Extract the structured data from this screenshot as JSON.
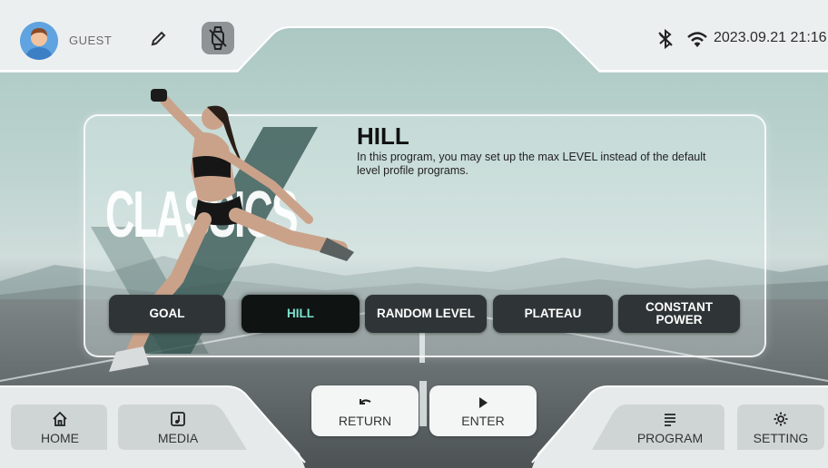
{
  "header": {
    "user_name": "GUEST",
    "datetime": "2023.09.21 21:16",
    "icons": [
      "avatar-icon",
      "pencil-icon",
      "watch-off-icon",
      "bluetooth-icon",
      "wifi-icon"
    ]
  },
  "panel": {
    "program_title": "HILL",
    "program_description": "In this program, you may set up the max LEVEL instead of the default level profile programs.",
    "category": "CLASSICS",
    "programs": [
      {
        "label": "GOAL",
        "active": false
      },
      {
        "label": "HILL",
        "active": true
      },
      {
        "label": "RANDOM LEVEL",
        "active": false
      },
      {
        "label": "PLATEAU",
        "active": false
      },
      {
        "label": "CONSTANT POWER",
        "active": false
      }
    ]
  },
  "footer": {
    "home": "HOME",
    "media": "MEDIA",
    "return": "RETURN",
    "enter": "ENTER",
    "program": "PROGRAM",
    "setting": "SETTING"
  },
  "colors": {
    "accent": "#7fe3cf",
    "button_dark": "#2f3536",
    "button_active": "#0f1413"
  }
}
